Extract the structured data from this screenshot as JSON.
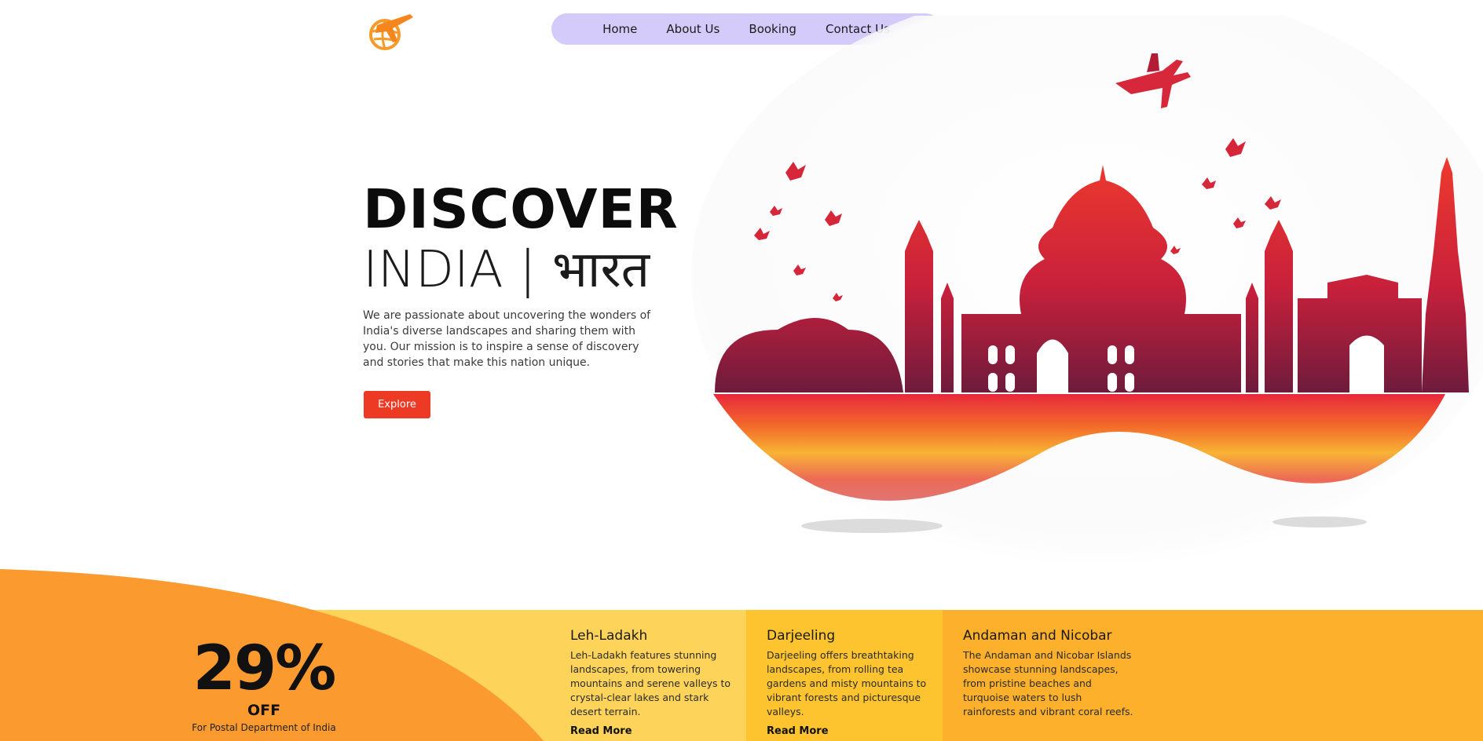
{
  "nav": {
    "items": [
      {
        "label": "Home"
      },
      {
        "label": "About Us"
      },
      {
        "label": "Booking"
      },
      {
        "label": "Contact Us"
      }
    ]
  },
  "hero": {
    "title_line1": "DISCOVER",
    "title_line2": "INDIA | भारत",
    "description": "We are passionate about uncovering the wonders of India's diverse landscapes and sharing them with you. Our mission is to inspire a sense of discovery and stories that make this nation unique.",
    "cta_label": "Explore"
  },
  "promo": {
    "percent": "29%",
    "off_label": "OFF",
    "note": "For Postal Department of India"
  },
  "destinations": [
    {
      "title": "Leh-Ladakh",
      "description": "Leh-Ladakh features stunning landscapes, from towering mountains and serene valleys to crystal-clear lakes and stark desert terrain.",
      "link": "Read More"
    },
    {
      "title": "Darjeeling",
      "description": "Darjeeling offers breathtaking landscapes, from rolling tea gardens and misty mountains to vibrant forests and picturesque valleys.",
      "link": "Read More"
    },
    {
      "title": "Andaman and Nicobar",
      "description": "The Andaman and Nicobar Islands showcase stunning landscapes, from pristine beaches and turquoise waters to lush rainforests and vibrant coral reefs.",
      "link": ""
    }
  ],
  "colors": {
    "nav_bg": "#d4cbfa",
    "cta": "#ec3a24",
    "promo_orange": "#fb9a2f",
    "band_light": "#fdd35a",
    "band_mid": "#fdc430",
    "band_dark": "#fcb02c"
  },
  "icons": {
    "logo": "plane-globe-logo-icon",
    "airplane": "airplane-icon"
  }
}
